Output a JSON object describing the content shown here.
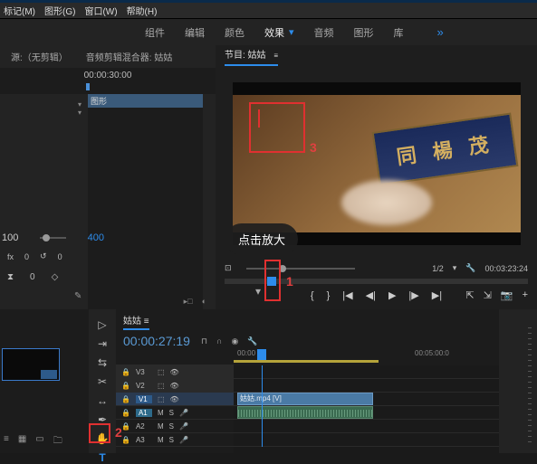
{
  "menubar": {
    "mark": "标记(M)",
    "graphic": "图形(G)",
    "window": "窗口(W)",
    "help": "帮助(H)"
  },
  "workspace": {
    "tabs": [
      "组件",
      "编辑",
      "颜色",
      "效果",
      "音频",
      "图形",
      "库"
    ],
    "active_index": 3,
    "more": "»"
  },
  "source_panel": {
    "tab1": "源:（无剪辑）",
    "tab2": "音频剪辑混合器: 姑姑",
    "end_time": "00:00:30:00",
    "clip_name": "图形",
    "fit_left": "100",
    "fit_right": "400",
    "val0": "0",
    "valp": "0"
  },
  "program_panel": {
    "tab": "节目: 姑姑",
    "tooltip": "点击放大",
    "zoom": "1/2",
    "timecode": "00:03:23:24",
    "sign_text": "同 楊 茂"
  },
  "timeline": {
    "tab": "姑姑",
    "timecode": "00:00:27:19",
    "ruler": {
      "t0": "00:00",
      "t1": "00:05:00:0"
    },
    "tracks": {
      "v3": "V3",
      "v2": "V2",
      "v1": "V1",
      "a1": "A1",
      "a2": "A2",
      "a3": "A3"
    },
    "clip_v1": "姑姑.mp4 [V]",
    "m": "M",
    "s": "S"
  },
  "annotations": {
    "n1": "1",
    "n2": "2",
    "n3": "3"
  }
}
